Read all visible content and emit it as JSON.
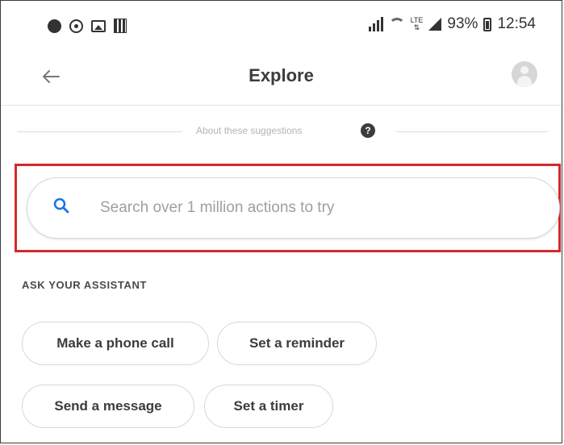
{
  "status_bar": {
    "battery_percent": "93%",
    "time": "12:54",
    "network_label": "LTE",
    "left_icons": [
      "record-icon",
      "whatsapp-icon",
      "gallery-icon",
      "news-icon"
    ],
    "right_icons": [
      "signal-bars-icon",
      "wifi-icon",
      "lte-icon",
      "cell-signal-icon",
      "battery-icon"
    ]
  },
  "app_bar": {
    "back_icon": "arrow-left-icon",
    "title": "Explore",
    "avatar_icon": "account-avatar-icon"
  },
  "about": {
    "text": "About these suggestions",
    "help_glyph": "?"
  },
  "search": {
    "placeholder": "Search over 1 million actions to try",
    "icon": "search-icon",
    "icon_color": "#1a73e8"
  },
  "assistant_section": {
    "heading": "ASK YOUR ASSISTANT",
    "chips": [
      "Make a phone call",
      "Set a reminder",
      "Send a message",
      "Set a timer"
    ]
  },
  "colors": {
    "highlight_border": "#d62828",
    "search_icon": "#1a73e8",
    "text_primary": "#3c3c3c",
    "placeholder": "#9aa0a6"
  }
}
